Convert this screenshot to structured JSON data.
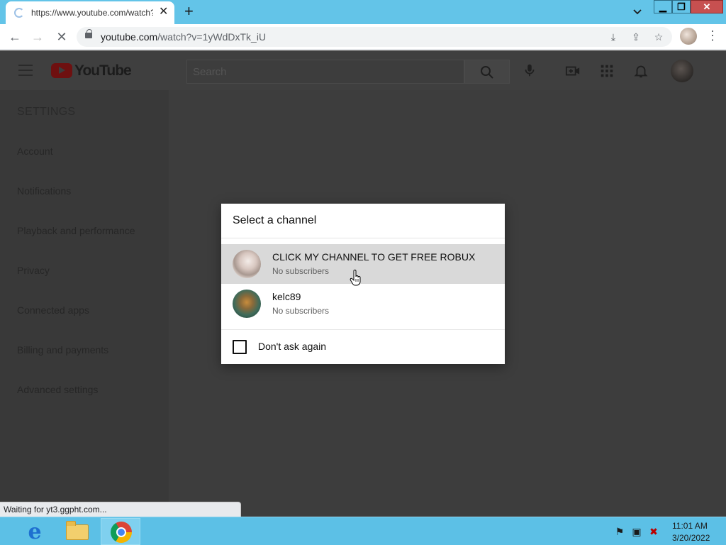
{
  "browser": {
    "tab_title": "https://www.youtube.com/watch?v=1yWdDxTk_iU",
    "tab_close": "✕",
    "new_tab": "+",
    "url_host": "youtube.com",
    "url_path": "/watch?v=1yWdDxTk_iU",
    "status_text": "Waiting for yt3.ggpht.com..."
  },
  "youtube": {
    "logo_text": "YouTube",
    "search_placeholder": "Search",
    "settings_heading": "SETTINGS",
    "sidebar_items": [
      {
        "label": "Account"
      },
      {
        "label": "Notifications"
      },
      {
        "label": "Playback and performance"
      },
      {
        "label": "Privacy"
      },
      {
        "label": "Connected apps"
      },
      {
        "label": "Billing and payments"
      },
      {
        "label": "Advanced settings"
      }
    ]
  },
  "dialog": {
    "title": "Select a channel",
    "channels": [
      {
        "name": "CLICK MY CHANNEL TO GET FREE ROBUX",
        "subscribers": "No subscribers",
        "hovered": true
      },
      {
        "name": "kelc89",
        "subscribers": "No subscribers",
        "hovered": false
      }
    ],
    "checkbox_label": "Don't ask again",
    "checkbox_checked": false
  },
  "taskbar": {
    "apps": [
      {
        "name": "internet-explorer-icon",
        "active": false
      },
      {
        "name": "file-explorer-icon",
        "active": false
      },
      {
        "name": "chrome-icon",
        "active": true
      }
    ],
    "time": "11:01 AM",
    "date": "3/20/2022"
  },
  "colors": {
    "titlebar": "#63c4e8",
    "taskbar": "#5cc0e6",
    "page_overlay": "#3d3d3d",
    "hover_row": "#d9d9d9"
  }
}
